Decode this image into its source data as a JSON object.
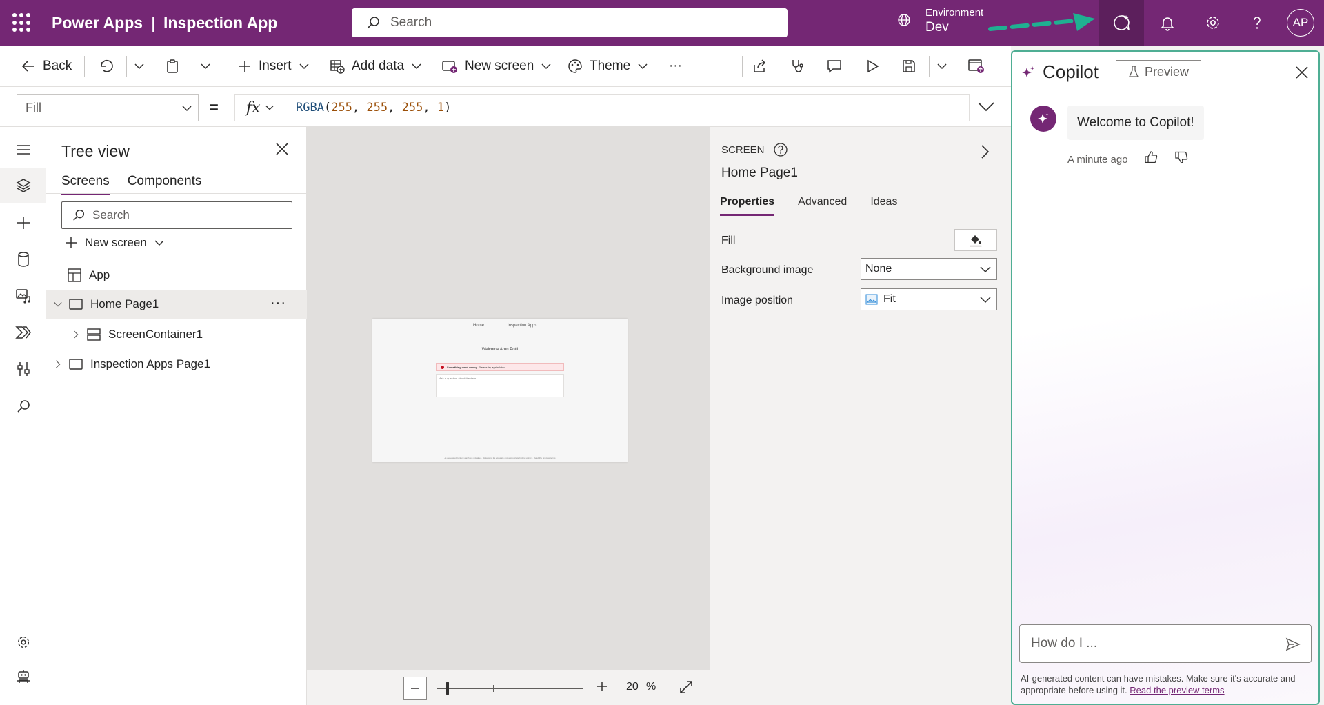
{
  "header": {
    "product": "Power Apps",
    "separator": "|",
    "app_name": "Inspection App",
    "search_placeholder": "Search",
    "environment_label": "Environment",
    "environment_value": "Dev",
    "avatar_initials": "AP",
    "brand_color": "#742774"
  },
  "commandbar": {
    "back": "Back",
    "insert": "Insert",
    "add_data": "Add data",
    "new_screen": "New screen",
    "theme": "Theme",
    "more": "···"
  },
  "formula": {
    "property": "Fill",
    "equals": "=",
    "fx": "fx",
    "fn": "RGBA",
    "open": "(",
    "a1": "255",
    "c1": ", ",
    "a2": "255",
    "c2": ", ",
    "a3": "255",
    "c3": ", ",
    "a4": "1",
    "close": ")"
  },
  "tree": {
    "title": "Tree view",
    "tabs": [
      "Screens",
      "Components"
    ],
    "search_placeholder": "Search",
    "new_screen": "New screen",
    "items": [
      {
        "label": "App"
      },
      {
        "label": "Home Page1",
        "more": "···"
      },
      {
        "label": "ScreenContainer1"
      },
      {
        "label": "Inspection Apps Page1"
      }
    ]
  },
  "canvas": {
    "preview_tabs": [
      "Home",
      "Inspection Apps"
    ],
    "preview_welcome": "Welcome Arun Potti",
    "preview_error_bold": "Something went wrong.",
    "preview_error_rest": "Please try again later.",
    "preview_input_placeholder": "Ask a question about the data",
    "preview_footer": "AI-generated content can have mistakes. Make sure it's accurate and appropriate before using it. Read the preview terms",
    "zoom_value": "20",
    "zoom_unit": "%"
  },
  "properties": {
    "type": "SCREEN",
    "name": "Home Page1",
    "tabs": [
      "Properties",
      "Advanced",
      "Ideas"
    ],
    "fill_label": "Fill",
    "background_label": "Background image",
    "background_value": "None",
    "position_label": "Image position",
    "position_value": "Fit"
  },
  "copilot": {
    "title": "Copilot",
    "preview": "Preview",
    "message": "Welcome to Copilot!",
    "time": "A minute ago",
    "input_placeholder": "How do I ...",
    "disclaimer": "AI-generated content can have mistakes. Make sure it's accurate and appropriate before using it.",
    "terms_link": "Read the preview terms",
    "border_color": "#4fae94"
  }
}
